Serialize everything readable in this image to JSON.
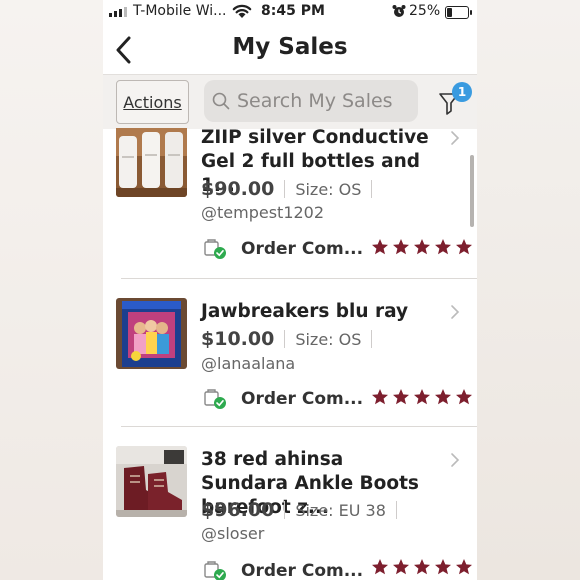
{
  "status_bar": {
    "carrier": "T-Mobile Wi...",
    "time": "8:45 PM",
    "battery": "25%"
  },
  "nav": {
    "title": "My Sales"
  },
  "toolbar": {
    "actions_label": "Actions",
    "search_placeholder": "Search My Sales",
    "filter_count": "1"
  },
  "rating_color": "#7d1f2e",
  "items": [
    {
      "title": "ZIIP silver Conductive Gel 2 full bottles and 1...",
      "price": "$90.00",
      "size": "Size: OS",
      "buyer": "@tempest1202",
      "status": "Order Com...",
      "rating": 5
    },
    {
      "title": "Jawbreakers blu ray",
      "price": "$10.00",
      "size": "Size: OS",
      "buyer": "@lanaalana",
      "status": "Order Com...",
      "rating": 5
    },
    {
      "title": "38 red ahinsa Sundara Ankle Boots barefoot z...",
      "price": "$96.00",
      "size": "Size: EU 38",
      "buyer": "@sloser",
      "status": "Order Com...",
      "rating": 5
    }
  ]
}
